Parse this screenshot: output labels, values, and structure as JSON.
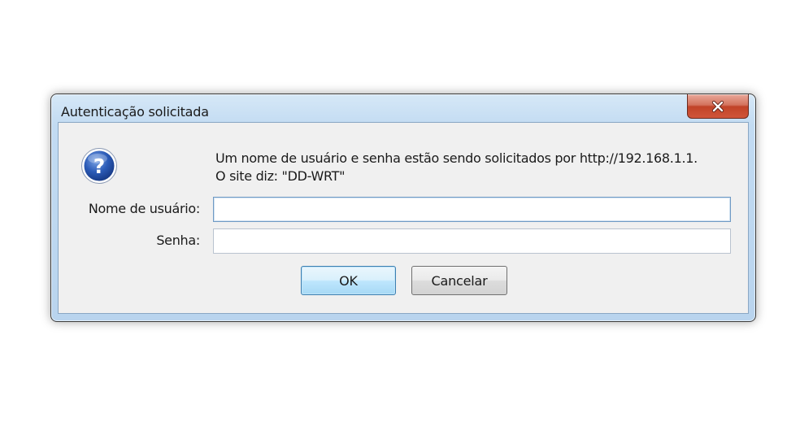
{
  "dialog": {
    "title": "Autenticação solicitada",
    "message_line1": "Um nome de usuário e senha estão sendo solicitados por http://192.168.1.1.",
    "message_line2": "O site diz: \"DD-WRT\"",
    "username_label": "Nome de usuário:",
    "username_value": "",
    "password_label": "Senha:",
    "password_value": "",
    "ok_label": "OK",
    "cancel_label": "Cancelar",
    "icons": {
      "close": "close-icon",
      "question": "question-icon"
    },
    "colors": {
      "close_button": "#c84a2f",
      "question_icon": "#2a55a8",
      "frame": "#c2dbf2",
      "client_bg": "#f0f0f0"
    }
  }
}
